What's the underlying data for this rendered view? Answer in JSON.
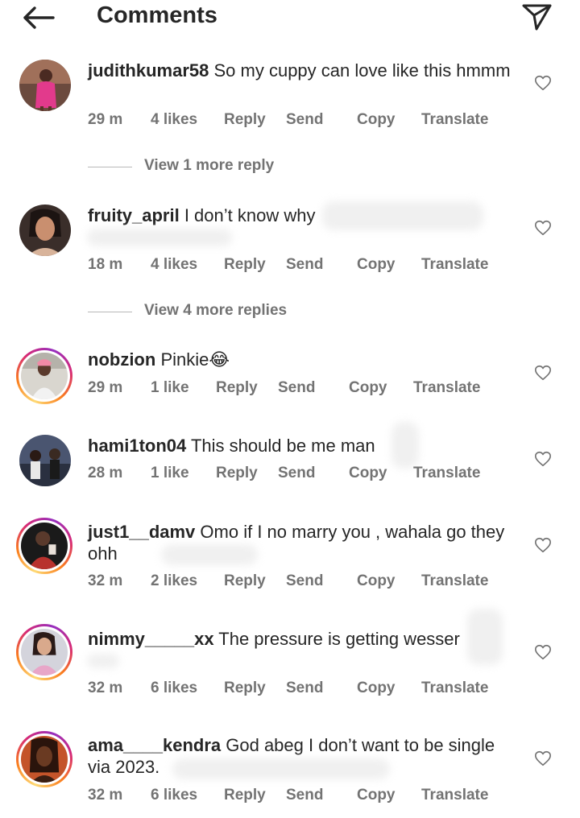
{
  "header": {
    "title": "Comments",
    "back_icon": "arrow-left-icon",
    "share_icon": "paper-plane-icon"
  },
  "comments": [
    {
      "username": "judithkumar58",
      "text": "So my cuppy can love like this hmmm",
      "time": "29 m",
      "likes": "4 likes",
      "reply": "Reply",
      "send": "Send",
      "copy": "Copy",
      "translate": "Translate",
      "view_replies": "View 1 more reply",
      "story_ring": false
    },
    {
      "username": "fruity_april",
      "text": "I don’t know why",
      "time": "18 m",
      "likes": "4 likes",
      "reply": "Reply",
      "send": "Send",
      "copy": "Copy",
      "translate": "Translate",
      "view_replies": "View 4 more replies",
      "story_ring": false
    },
    {
      "username": "nobzion",
      "text": "Pinkie😂",
      "time": "29 m",
      "likes": "1 like",
      "reply": "Reply",
      "send": "Send",
      "copy": "Copy",
      "translate": "Translate",
      "story_ring": true
    },
    {
      "username": "hami1ton04",
      "text": "This should be me man",
      "time": "28 m",
      "likes": "1 like",
      "reply": "Reply",
      "send": "Send",
      "copy": "Copy",
      "translate": "Translate",
      "story_ring": false
    },
    {
      "username": "just1__damv",
      "text": "Omo if I no marry you , wahala go they ohh",
      "time": "32 m",
      "likes": "2 likes",
      "reply": "Reply",
      "send": "Send",
      "copy": "Copy",
      "translate": "Translate",
      "story_ring": true
    },
    {
      "username": "nimmy_____xx",
      "text": "The pressure is getting wesser",
      "time": "32 m",
      "likes": "6 likes",
      "reply": "Reply",
      "send": "Send",
      "copy": "Copy",
      "translate": "Translate",
      "story_ring": true
    },
    {
      "username": "ama____kendra",
      "text": "God abeg I don’t want to be single via 2023.",
      "time": "32 m",
      "likes": "6 likes",
      "reply": "Reply",
      "send": "Send",
      "copy": "Copy",
      "translate": "Translate",
      "story_ring": true
    }
  ],
  "colors": {
    "text": "#262626",
    "secondary": "#737373",
    "ring_start": "#feda75",
    "ring_end": "#d62976"
  }
}
